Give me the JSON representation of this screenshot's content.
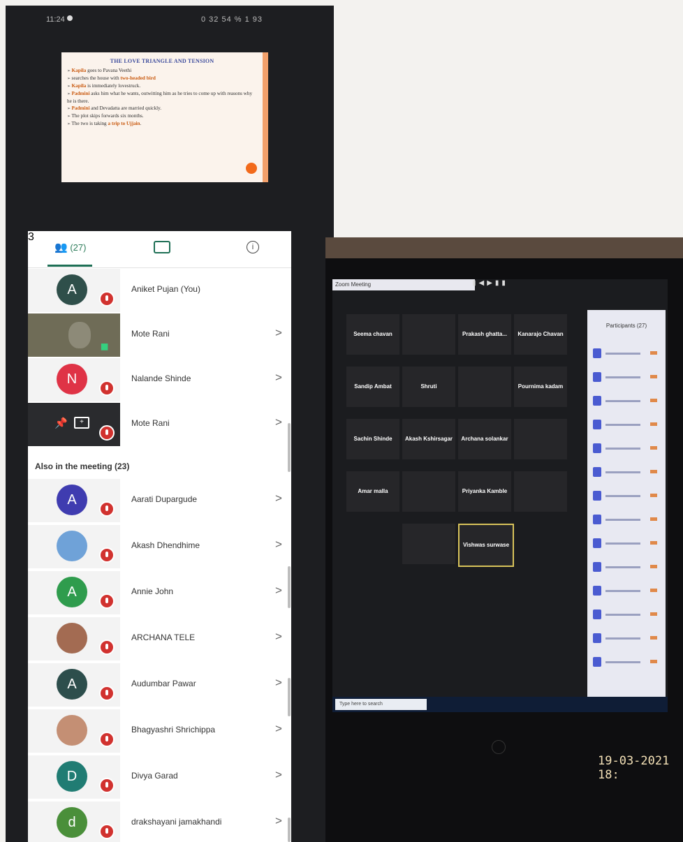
{
  "status_bar": {
    "time": "11:24",
    "indicators": "0 32 54 % 1 93"
  },
  "slide": {
    "title": "THE LOVE TRIANGLE AND TENSION",
    "bullets": [
      {
        "pre": "",
        "hl": "Kapila",
        "post": " goes to Pavana Veethi"
      },
      {
        "pre": "searches the house with ",
        "hl": "two-headed bird",
        "post": ""
      },
      {
        "pre": "",
        "hl": "Kapila",
        "post": " is immediately lovestruck."
      },
      {
        "pre": "",
        "hl": "Padmini",
        "post": " asks him what he wants, outwitting him as he tries to come up with reasons why he is there."
      },
      {
        "pre": "",
        "hl": "Padmini",
        "post": " and Devadatta are married quickly."
      },
      {
        "pre": "The plot skips forwards six months.",
        "hl": "",
        "post": ""
      },
      {
        "pre": "The two is taking ",
        "hl": "a trip to Ujjain",
        "post": "."
      }
    ]
  },
  "tabs": {
    "people_count": "(27)",
    "chat_badge": "3",
    "info_icon": "i"
  },
  "participants_top": [
    {
      "name": "Aniket Pujan (You)",
      "initial": "A",
      "color": "#2f4f4a",
      "kind": "avatar",
      "chevron": ""
    },
    {
      "name": "Mote Rani",
      "initial": "",
      "color": "",
      "kind": "video",
      "chevron": ">"
    },
    {
      "name": "Nalande Shinde",
      "initial": "N",
      "color": "#df3346",
      "kind": "avatar",
      "chevron": ">"
    },
    {
      "name": "Mote Rani",
      "initial": "",
      "color": "",
      "kind": "share",
      "chevron": ">"
    }
  ],
  "section_label": "Also in the meeting (23)",
  "participants_also": [
    {
      "name": "Aarati Dupargude",
      "initial": "A",
      "color": "#3f3cb0",
      "kind": "avatar"
    },
    {
      "name": "Akash Dhendhime",
      "initial": "",
      "color": "#6fa2d8",
      "kind": "photo"
    },
    {
      "name": "Annie John",
      "initial": "A",
      "color": "#2f9c4d",
      "kind": "avatar"
    },
    {
      "name": "ARCHANA TELE",
      "initial": "",
      "color": "#a36b52",
      "kind": "photo"
    },
    {
      "name": "Audumbar Pawar",
      "initial": "A",
      "color": "#2d4e4c",
      "kind": "avatar"
    },
    {
      "name": "Bhagyashri Shrichippa",
      "initial": "",
      "color": "#c48f74",
      "kind": "photo"
    },
    {
      "name": "Divya Garad",
      "initial": "D",
      "color": "#207c73",
      "kind": "avatar"
    },
    {
      "name": "drakshayani jamakhandi",
      "initial": "d",
      "color": "#4a8f3a",
      "kind": "avatar"
    }
  ],
  "chevron": ">",
  "laptop": {
    "window_title": "Zoom Meeting",
    "gallery_tiles": [
      "Seema chavan",
      "",
      "Prakash ghatta...",
      "Kanarajo Chavan",
      "Sandip Ambat",
      "Shruti",
      "",
      "Pournima kadam",
      "Sachin Shinde",
      "Akash Kshirsagar",
      "Archana solankar",
      "",
      "Amar malla",
      "",
      "Priyanka Kamble",
      "",
      "",
      "Vishwas surwase"
    ],
    "panel_title": "Participants (27)",
    "search_placeholder": "Type here to search",
    "date_stamp": "19-03-2021 18:"
  }
}
